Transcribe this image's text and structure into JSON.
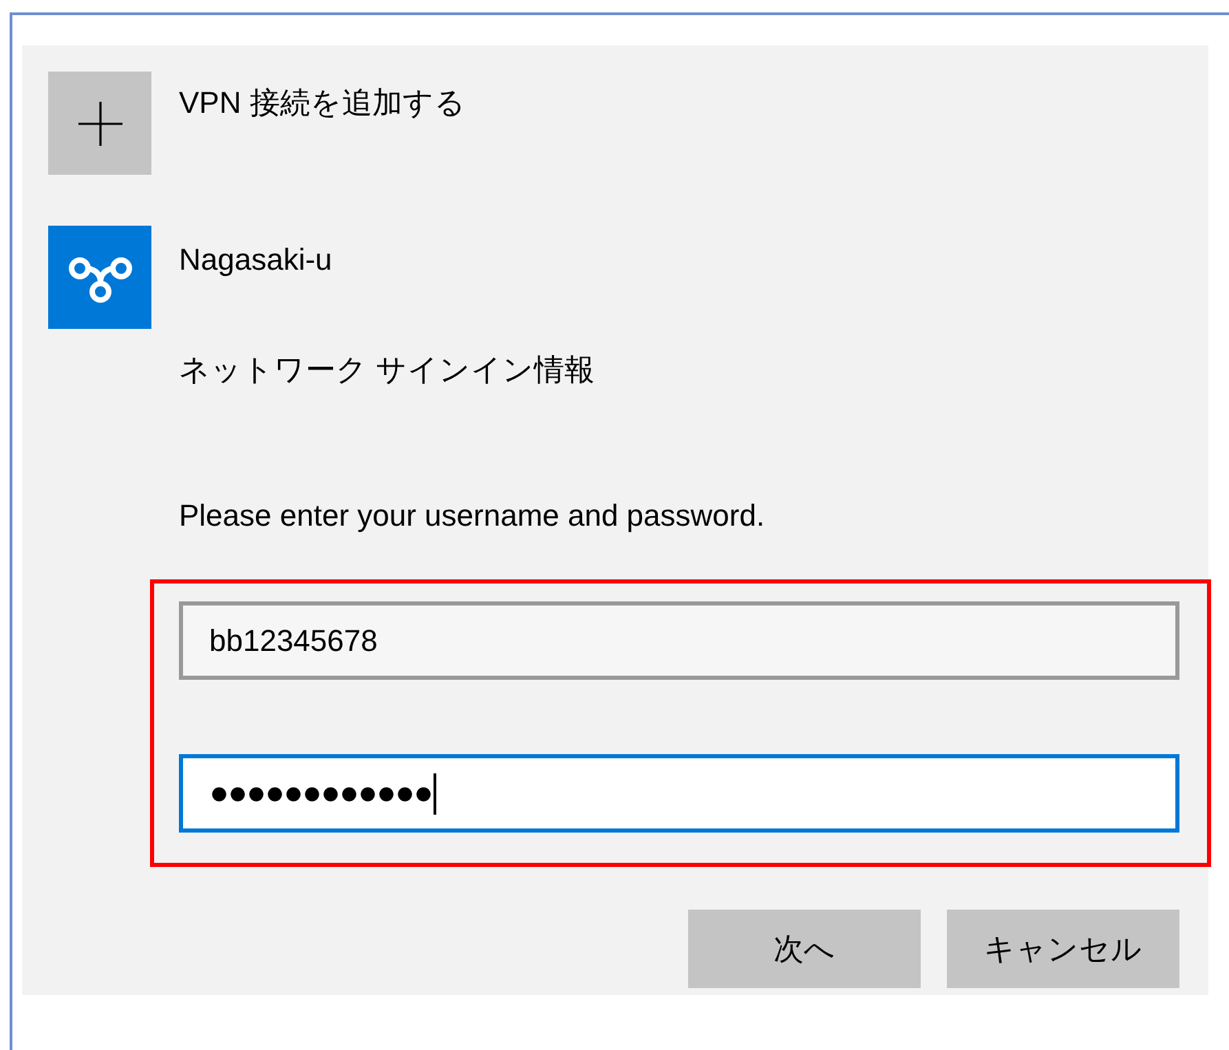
{
  "add_vpn": {
    "label": "VPN 接続を追加する"
  },
  "connection": {
    "name": "Nagasaki-u",
    "subtitle": "ネットワーク サインイン情報"
  },
  "prompt": "Please enter your username and password.",
  "highlight_box": true,
  "fields": [
    {
      "kind": "text",
      "value": "bb12345678",
      "focused": false
    },
    {
      "kind": "password",
      "value": "●●●●●●●●●●●●",
      "focused": true
    }
  ],
  "buttons": [
    {
      "label": "次へ"
    },
    {
      "label": "キャンセル"
    }
  ]
}
